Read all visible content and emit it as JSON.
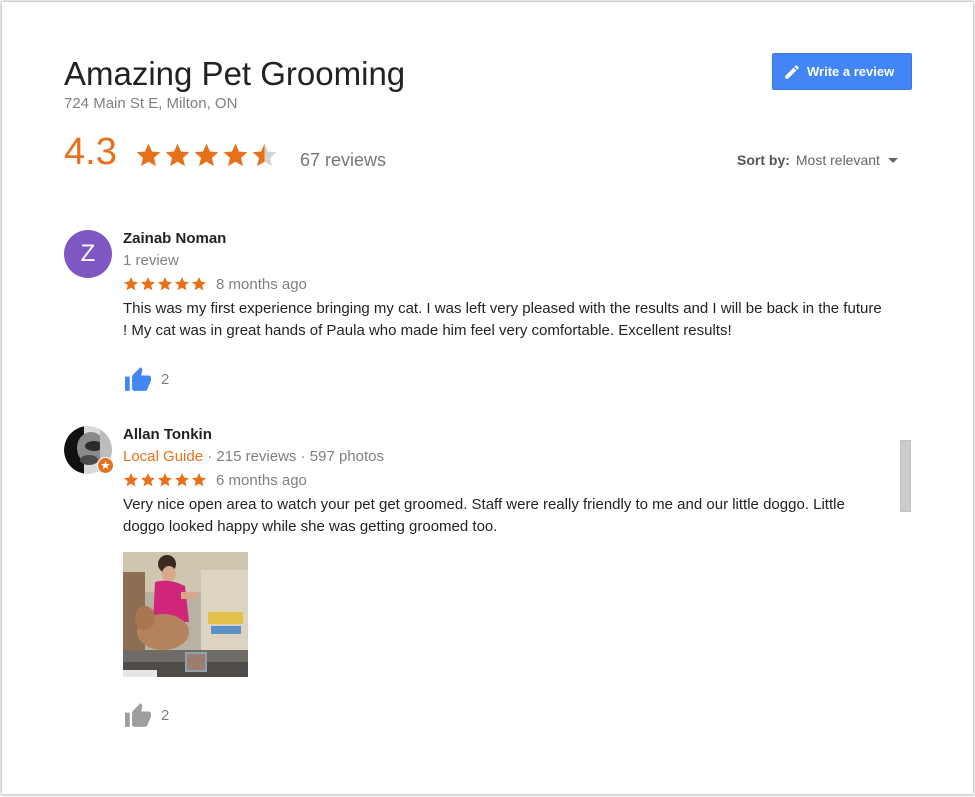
{
  "business": {
    "name": "Amazing Pet Grooming",
    "address": "724 Main St E, Milton, ON",
    "rating": "4.3",
    "rating_value": 4.3,
    "review_count": "67 reviews"
  },
  "toolbar": {
    "write_review_label": "Write a review",
    "sort_label": "Sort by:",
    "sort_value": "Most relevant"
  },
  "colors": {
    "accent_orange": "#e7711b",
    "button_blue": "#4285f4",
    "like_blue": "#4285f4",
    "like_gray": "#9e9e9e",
    "avatar_purple": "#7e57c2"
  },
  "reviews": [
    {
      "author": "Zainab Noman",
      "avatar_letter": "Z",
      "meta": "1 review",
      "stars": 5,
      "date": "8 months ago",
      "text": "This was my first experience bringing my cat. I was left very pleased with the results and I will be back in the future ! My cat was in great hands of Paula who made him feel very comfortable. Excellent results!",
      "likes": "2",
      "like_icon": "thumbs-up-icon"
    },
    {
      "author": "Allan Tonkin",
      "guide_label": "Local Guide",
      "meta": " · 215 reviews · 597 photos",
      "stars": 5,
      "date": "6 months ago",
      "text": "Very nice open area to watch your pet get groomed. Staff were really friendly to me and our little doggo. Little doggo looked happy while she was getting groomed too.",
      "likes": "2",
      "like_icon": "thumbs-up-icon"
    }
  ]
}
